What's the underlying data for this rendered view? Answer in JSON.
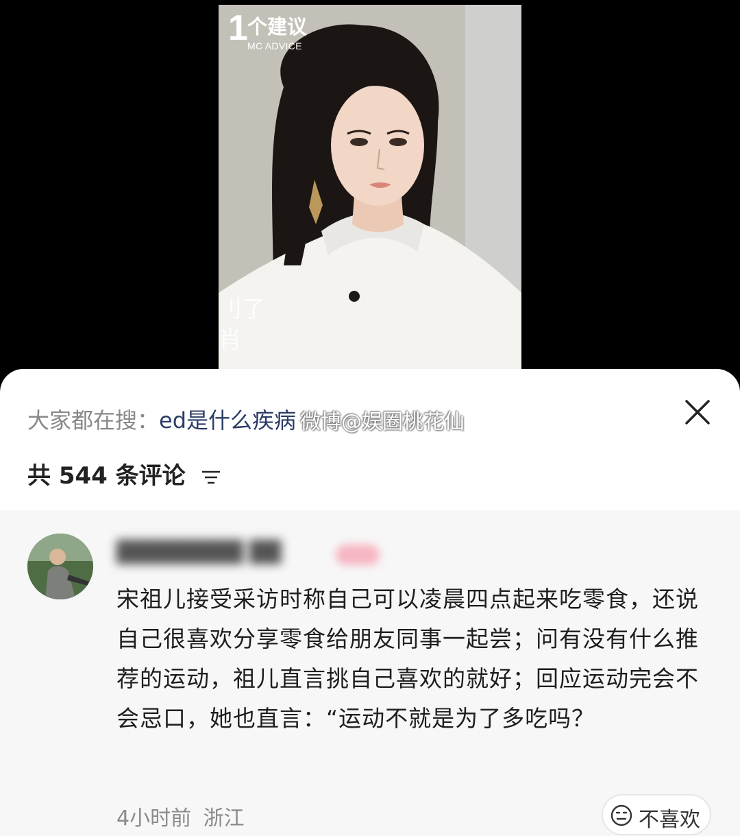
{
  "video": {
    "brand_number": "1",
    "brand_title": "个建议",
    "brand_subtitle": "MC ADVICE",
    "avatar_icon": "portrait-photo"
  },
  "sheet": {
    "search_prefix": "大家都在搜：",
    "search_query": "ed是什么疾病",
    "watermark": "微博@娱圈桃花仙",
    "close_icon": "close-icon",
    "comment_count_label": "共 544 条评论",
    "sort_icon": "sort-lines-icon"
  },
  "comment": {
    "text": "宋祖儿接受采访时称自己可以凌晨四点起来吃零食，还说自己很喜欢分享零食给朋友同事一起尝；问有没有什么推荐的运动，祖儿直言挑自己喜欢的就好；回应运动完会不会忌口，她也直言：“运动不就是为了多吃吗？",
    "time": "4小时前",
    "location": "浙江",
    "dislike_label": "不喜欢",
    "dislike_icon": "unhappy-face-icon"
  },
  "colors": {
    "sheet_bg": "#ffffff",
    "comment_bg": "#f7f7f7",
    "query_color": "#2b3b66"
  }
}
